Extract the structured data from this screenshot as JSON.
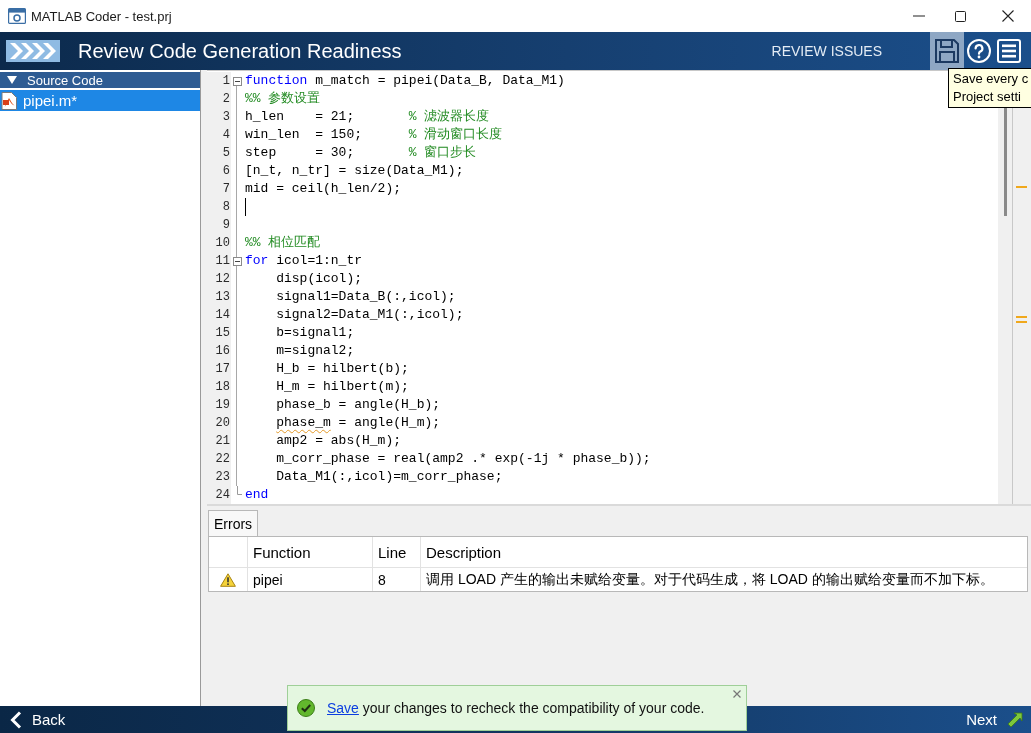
{
  "window": {
    "title": "MATLAB Coder - test.prj"
  },
  "header": {
    "title": "Review Code Generation Readiness",
    "step": "REVIEW ISSUES",
    "tools": [
      {
        "kind": "save",
        "highlighted": true
      },
      {
        "kind": "help",
        "highlighted": false
      },
      {
        "kind": "menu",
        "highlighted": false
      }
    ]
  },
  "tooltip": {
    "lines": [
      "Save every c",
      "Project setti"
    ]
  },
  "sidebar": {
    "header": "Source Code",
    "expanded": true,
    "items": [
      {
        "label": "pipei.m*",
        "selected": true
      }
    ]
  },
  "editor": {
    "lines": [
      {
        "number": "1",
        "kind": "opener",
        "cursor": false,
        "tokens": [
          {
            "kind": "keyword",
            "text": "function"
          },
          {
            "kind": "plain",
            "text": " m_match = pipei(Data_B, Data_M1)"
          }
        ]
      },
      {
        "number": "2",
        "kind": "plain",
        "cursor": false,
        "tokens": [
          {
            "kind": "comment",
            "text": "%% 参数设置"
          }
        ]
      },
      {
        "number": "3",
        "kind": "plain",
        "cursor": false,
        "tokens": [
          {
            "kind": "plain",
            "text": "h_len    = 21;       "
          },
          {
            "kind": "comment",
            "text": "% 滤波器长度"
          }
        ]
      },
      {
        "number": "4",
        "kind": "plain",
        "cursor": false,
        "tokens": [
          {
            "kind": "plain",
            "text": "win_len  = 150;      "
          },
          {
            "kind": "comment",
            "text": "% 滑动窗口长度"
          }
        ]
      },
      {
        "number": "5",
        "kind": "plain",
        "cursor": false,
        "tokens": [
          {
            "kind": "plain",
            "text": "step     = 30;       "
          },
          {
            "kind": "comment",
            "text": "% 窗口步长"
          }
        ]
      },
      {
        "number": "6",
        "kind": "plain",
        "cursor": false,
        "tokens": [
          {
            "kind": "plain",
            "text": "[n_t, n_tr] = size(Data_M1);"
          }
        ]
      },
      {
        "number": "7",
        "kind": "plain",
        "cursor": false,
        "tokens": [
          {
            "kind": "plain",
            "text": "mid = ceil(h_len/2);"
          }
        ]
      },
      {
        "number": "8",
        "kind": "plain",
        "cursor": true
      },
      {
        "number": "9",
        "kind": "plain",
        "cursor": false
      },
      {
        "number": "10",
        "kind": "plain",
        "cursor": false,
        "tokens": [
          {
            "kind": "comment",
            "text": "%% 相位匹配"
          }
        ]
      },
      {
        "number": "11",
        "kind": "opener",
        "cursor": false,
        "tokens": [
          {
            "kind": "keyword",
            "text": "for"
          },
          {
            "kind": "plain",
            "text": " icol=1:n_tr"
          }
        ],
        "children": [
          {
            "number": "12",
            "kind": "plain",
            "cursor": false,
            "tokens": [
              {
                "kind": "plain",
                "text": "disp(icol);"
              }
            ]
          },
          {
            "number": "13",
            "kind": "plain",
            "cursor": false,
            "tokens": [
              {
                "kind": "plain",
                "text": "signal1=Data_B(:,icol);"
              }
            ]
          },
          {
            "number": "14",
            "kind": "plain",
            "cursor": false,
            "tokens": [
              {
                "kind": "plain",
                "text": "signal2=Data_M1(:,icol);"
              }
            ]
          },
          {
            "number": "15",
            "kind": "plain",
            "cursor": false,
            "tokens": [
              {
                "kind": "plain",
                "text": "b=signal1;"
              }
            ]
          },
          {
            "number": "16",
            "kind": "plain",
            "cursor": false,
            "tokens": [
              {
                "kind": "plain",
                "text": "m=signal2;"
              }
            ]
          },
          {
            "number": "17",
            "kind": "plain",
            "cursor": false,
            "tokens": [
              {
                "kind": "plain",
                "text": "H_b = hilbert(b);"
              }
            ]
          },
          {
            "number": "18",
            "kind": "plain",
            "cursor": false,
            "tokens": [
              {
                "kind": "plain",
                "text": "H_m = hilbert(m);"
              }
            ]
          },
          {
            "number": "19",
            "kind": "plain",
            "cursor": false,
            "tokens": [
              {
                "kind": "plain",
                "text": "phase_b = angle(H_b);"
              }
            ]
          },
          {
            "number": "20",
            "kind": "plain",
            "cursor": false,
            "tokens": [
              {
                "kind": "warning",
                "text": "phase_m"
              },
              {
                "kind": "plain",
                "text": " = angle(H_m);"
              }
            ]
          },
          {
            "number": "21",
            "kind": "plain",
            "cursor": false,
            "tokens": [
              {
                "kind": "plain",
                "text": "amp2 = abs(H_m);"
              }
            ]
          },
          {
            "number": "22",
            "kind": "plain",
            "cursor": false,
            "tokens": [
              {
                "kind": "plain",
                "text": "m_corr_phase = real(amp2 .* exp(-1j * phase_b));"
              }
            ]
          },
          {
            "number": "23",
            "kind": "plain",
            "cursor": false,
            "tokens": [
              {
                "kind": "plain",
                "text": "Data_M1(:,icol)=m_corr_phase;"
              }
            ]
          }
        ]
      },
      {
        "number": "24",
        "kind": "closer",
        "cursor": false,
        "tokens": [
          {
            "kind": "keyword",
            "text": "end"
          }
        ]
      }
    ]
  },
  "errors_panel": {
    "tabs": [
      {
        "label": "Errors",
        "selected": true
      }
    ],
    "columns": [
      "Function",
      "Line",
      "Description"
    ],
    "rows": [
      {
        "kind": "warning",
        "function": "pipei",
        "line": "8",
        "description": "调用 LOAD 产生的输出未赋给变量。对于代码生成，将 LOAD 的输出赋给变量而不加下标。"
      }
    ]
  },
  "notification": {
    "link": "Save",
    "text": "your changes to recheck the compatibility of your code."
  },
  "footer": {
    "back": "Back",
    "next": "Next"
  }
}
